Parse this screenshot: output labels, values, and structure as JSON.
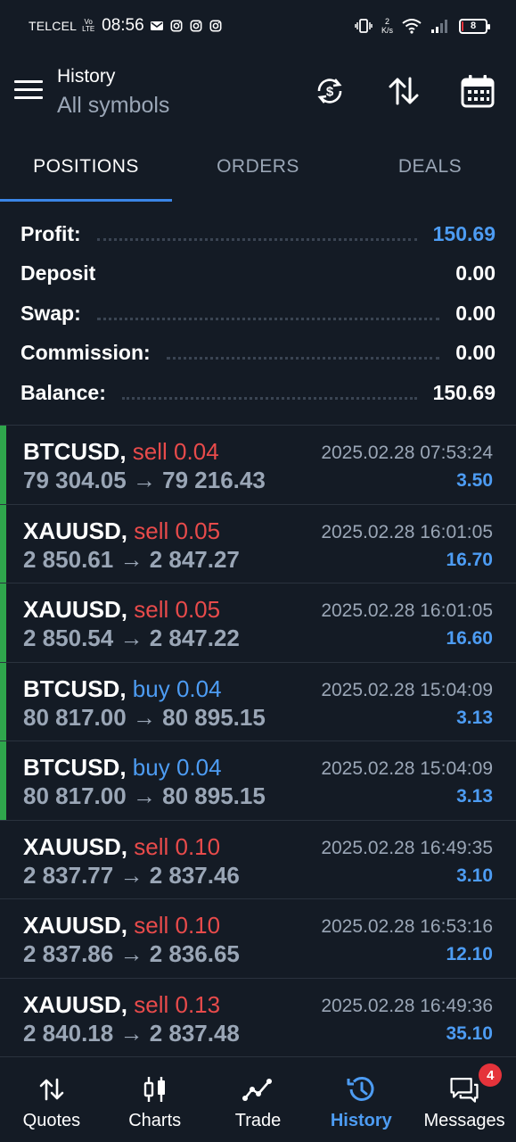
{
  "status_bar": {
    "carrier": "TELCEL",
    "network_tag": "Vo LTE",
    "time": "08:56",
    "net_speed_value": "2",
    "net_speed_unit": "K/s",
    "battery_level": "8",
    "battery_fraction": 0.08
  },
  "header": {
    "title": "History",
    "subtitle": "All symbols",
    "icons": [
      "currency-exchange-icon",
      "sort-icon",
      "calendar-icon"
    ]
  },
  "tabs": [
    {
      "label": "POSITIONS",
      "active": true
    },
    {
      "label": "ORDERS",
      "active": false
    },
    {
      "label": "DEALS",
      "active": false
    }
  ],
  "summary": [
    {
      "label": "Profit:",
      "value": "150.69",
      "highlight": true
    },
    {
      "label": "Deposit",
      "value": "0.00",
      "highlight": false
    },
    {
      "label": "Swap:",
      "value": "0.00",
      "highlight": false
    },
    {
      "label": "Commission:",
      "value": "0.00",
      "highlight": false
    },
    {
      "label": "Balance:",
      "value": "150.69",
      "highlight": false
    }
  ],
  "positions": [
    {
      "symbol": "BTCUSD,",
      "side": "sell",
      "volume": "0.04",
      "price_open": "79 304.05",
      "price_close": "79 216.43",
      "time": "2025.02.28 07:53:24",
      "profit": "3.50",
      "marked": true
    },
    {
      "symbol": "XAUUSD,",
      "side": "sell",
      "volume": "0.05",
      "price_open": "2 850.61",
      "price_close": "2 847.27",
      "time": "2025.02.28 16:01:05",
      "profit": "16.70",
      "marked": true
    },
    {
      "symbol": "XAUUSD,",
      "side": "sell",
      "volume": "0.05",
      "price_open": "2 850.54",
      "price_close": "2 847.22",
      "time": "2025.02.28 16:01:05",
      "profit": "16.60",
      "marked": true
    },
    {
      "symbol": "BTCUSD,",
      "side": "buy",
      "volume": "0.04",
      "price_open": "80 817.00",
      "price_close": "80 895.15",
      "time": "2025.02.28 15:04:09",
      "profit": "3.13",
      "marked": true
    },
    {
      "symbol": "BTCUSD,",
      "side": "buy",
      "volume": "0.04",
      "price_open": "80 817.00",
      "price_close": "80 895.15",
      "time": "2025.02.28 15:04:09",
      "profit": "3.13",
      "marked": true
    },
    {
      "symbol": "XAUUSD,",
      "side": "sell",
      "volume": "0.10",
      "price_open": "2 837.77",
      "price_close": "2 837.46",
      "time": "2025.02.28 16:49:35",
      "profit": "3.10",
      "marked": false
    },
    {
      "symbol": "XAUUSD,",
      "side": "sell",
      "volume": "0.10",
      "price_open": "2 837.86",
      "price_close": "2 836.65",
      "time": "2025.02.28 16:53:16",
      "profit": "12.10",
      "marked": false
    },
    {
      "symbol": "XAUUSD,",
      "side": "sell",
      "volume": "0.13",
      "price_open": "2 840.18",
      "price_close": "2 837.48",
      "time": "2025.02.28 16:49:36",
      "profit": "35.10",
      "marked": false
    }
  ],
  "arrow": "→",
  "bottom_nav": [
    {
      "label": "Quotes",
      "icon": "quotes-arrows-icon",
      "active": false
    },
    {
      "label": "Charts",
      "icon": "candlestick-chart-icon",
      "active": false
    },
    {
      "label": "Trade",
      "icon": "trend-line-icon",
      "active": false
    },
    {
      "label": "History",
      "icon": "history-clock-icon",
      "active": true
    },
    {
      "label": "Messages",
      "icon": "chat-bubbles-icon",
      "active": false,
      "badge": "4"
    }
  ],
  "colors": {
    "background": "#141b25",
    "accent_blue": "#4d9cf3",
    "sell_red": "#e84b4b",
    "marker_green": "#2fa64c",
    "muted_text": "#9aa6b6"
  }
}
